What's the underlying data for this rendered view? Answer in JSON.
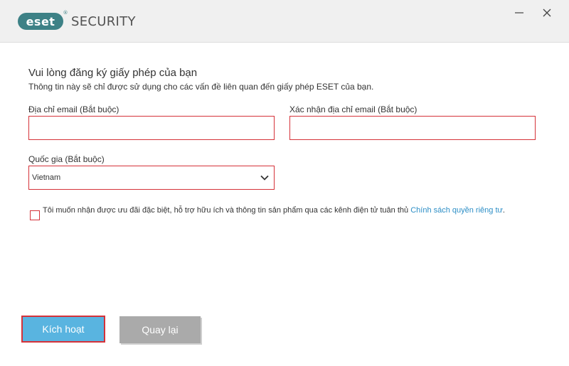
{
  "app": {
    "logo_text": "eset",
    "logo_reg": "®",
    "product": "SECURITY"
  },
  "window": {
    "minimize_glyph": "—",
    "close_glyph": "✕"
  },
  "form": {
    "heading": "Vui lòng đăng ký giấy phép của bạn",
    "subheading": "Thông tin này sẽ chỉ được sử dụng cho các vấn đề liên quan đến giấy phép ESET của bạn.",
    "email_label": "Địa chỉ email (Bắt buộc)",
    "email_value": "",
    "confirm_email_label": "Xác nhận địa chỉ email (Bắt buộc)",
    "confirm_email_value": "",
    "country_label": "Quốc gia (Bắt buộc)",
    "country_value": "Vietnam",
    "consent_text": "Tôi muốn nhận được ưu đãi đặc biệt, hỗ trợ hữu ích và thông tin sản phẩm qua các kênh điện tử tuân thủ ",
    "consent_link": "Chính sách quyền riêng tư",
    "consent_end": ".",
    "consent_checked": false
  },
  "buttons": {
    "activate_label": "Kích hoạt",
    "back_label": "Quay lại"
  },
  "colors": {
    "brand": "#3d8186",
    "error": "#d53239",
    "primary_button": "#59b4e0",
    "secondary_button": "#aaaaaa",
    "link": "#2c8ec6"
  },
  "icons": {
    "minimize": "minimize-icon",
    "close": "close-icon",
    "dropdown": "chevron-down-icon"
  }
}
